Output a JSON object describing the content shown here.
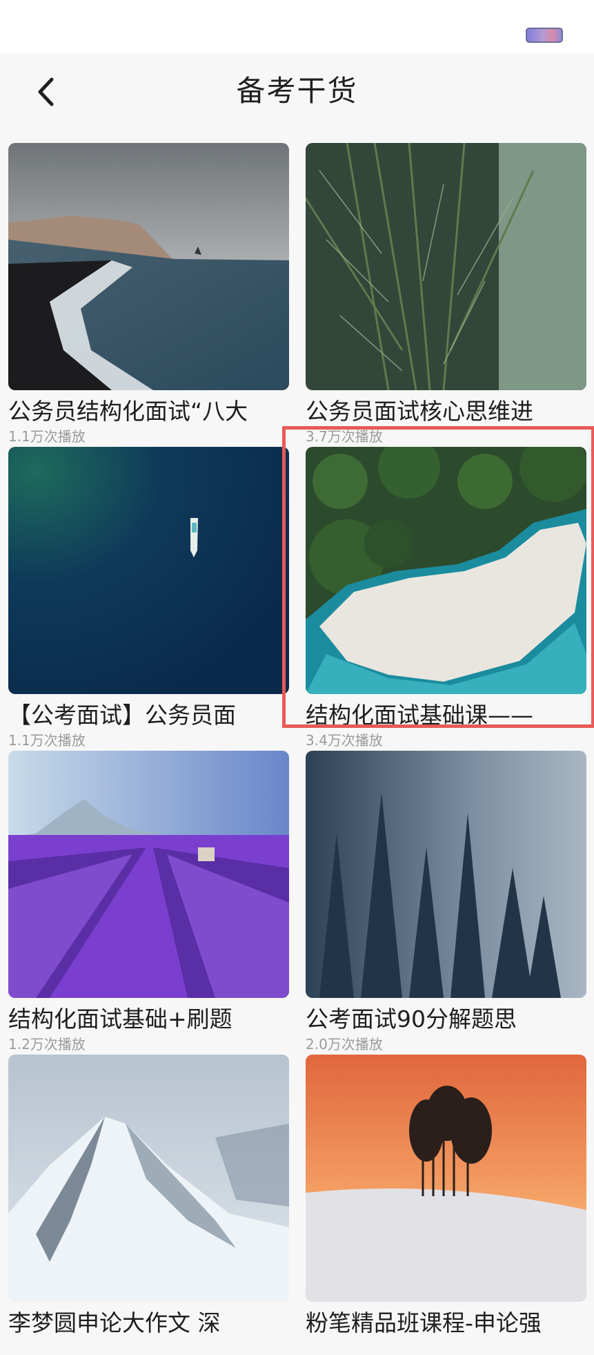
{
  "header": {
    "title": "备考干货"
  },
  "cards": [
    {
      "title": "公务员结构化面试“八大",
      "plays": "1.1万次播放",
      "image": "coastal-cliffs-black-beach"
    },
    {
      "title": "公务员面试核心思维进",
      "plays": "3.7万次播放",
      "image": "palm-fronds"
    },
    {
      "title": "【公考面试】公务员面",
      "plays": "1.1万次播放",
      "image": "boat-on-deep-sea"
    },
    {
      "title": "结构化面试基础课——",
      "plays": "3.4万次播放",
      "image": "aerial-forest-beach"
    },
    {
      "title": "结构化面试基础+刷题",
      "plays": "1.2万次播放",
      "image": "lavender-field"
    },
    {
      "title": "公考面试90分解题思",
      "plays": "2.0万次播放",
      "image": "misty-pine-forest"
    },
    {
      "title": "李梦圆申论大作文 深",
      "plays": "",
      "image": "snowy-mountain"
    },
    {
      "title": "粉笔精品班课程-申论强",
      "plays": "",
      "image": "trees-sunset-snow"
    }
  ],
  "highlight_color": "#e85a57"
}
